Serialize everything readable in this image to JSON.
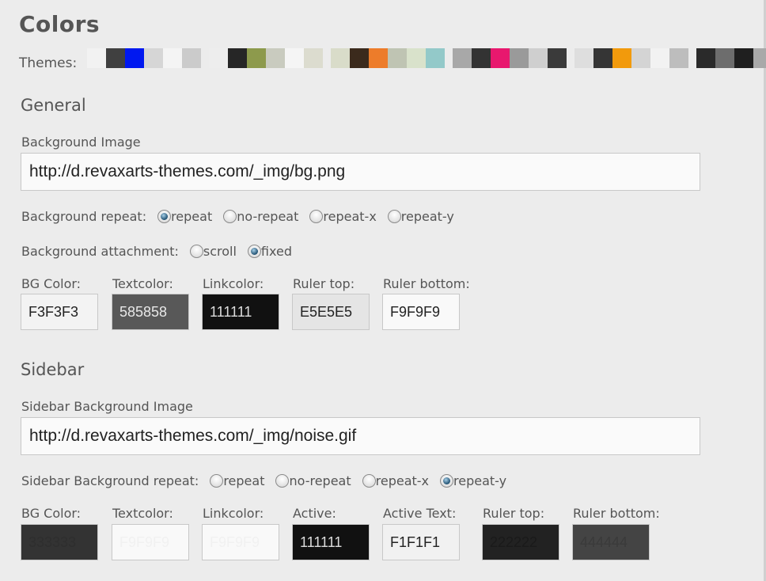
{
  "page": {
    "title": "Colors"
  },
  "themes": {
    "label": "Themes:",
    "sets": [
      [
        "#f2f2f2",
        "#404040",
        "#0018f0",
        "#d6d6d6",
        "#f4f4f4",
        "#cbcbcb"
      ],
      [
        "#ededed",
        "#262626",
        "#8d9a4c",
        "#c9cbbf",
        "#f5f5f5",
        "#dcdccf"
      ],
      [
        "#d9dcc9",
        "#3b2a1c",
        "#ed7c2a",
        "#bfc4b3",
        "#d9e2cb",
        "#93c9c9"
      ],
      [
        "#a8a8a8",
        "#333333",
        "#e8186e",
        "#9a9a9a",
        "#cfcfcf",
        "#3a3a3a"
      ],
      [
        "#dedede",
        "#353535",
        "#f29a0c",
        "#d4d4d4",
        "#f2f2f2",
        "#bdbdbd"
      ],
      [
        "#2a2a2a",
        "#6d6d6d",
        "#1f1f1f",
        "#a9a9a9"
      ]
    ]
  },
  "general": {
    "heading": "General",
    "bg_image_label": "Background Image",
    "bg_image_value": "http://d.revaxarts-themes.com/_img/bg.png",
    "repeat_label": "Background repeat:",
    "repeat_options": [
      "repeat",
      "no-repeat",
      "repeat-x",
      "repeat-y"
    ],
    "repeat_selected": "repeat",
    "attachment_label": "Background attachment:",
    "attachment_options": [
      "scroll",
      "fixed"
    ],
    "attachment_selected": "fixed",
    "colors": [
      {
        "label": "BG Color:",
        "value": "F3F3F3",
        "bg": "#f3f3f3",
        "fg": "#222222"
      },
      {
        "label": "Textcolor:",
        "value": "585858",
        "bg": "#585858",
        "fg": "#e8e8e8"
      },
      {
        "label": "Linkcolor:",
        "value": "111111",
        "bg": "#111111",
        "fg": "#dcdcdc"
      },
      {
        "label": "Ruler top:",
        "value": "E5E5E5",
        "bg": "#e5e5e5",
        "fg": "#222222"
      },
      {
        "label": "Ruler bottom:",
        "value": "F9F9F9",
        "bg": "#f9f9f9",
        "fg": "#222222"
      }
    ]
  },
  "sidebar": {
    "heading": "Sidebar",
    "bg_image_label": "Sidebar Background Image",
    "bg_image_value": "http://d.revaxarts-themes.com/_img/noise.gif",
    "repeat_label": "Sidebar Background repeat:",
    "repeat_options": [
      "repeat",
      "no-repeat",
      "repeat-x",
      "repeat-y"
    ],
    "repeat_selected": "repeat-y",
    "colors": [
      {
        "label": "BG Color:",
        "value": "333333",
        "bg": "#333333",
        "fg": "#2e2e2e"
      },
      {
        "label": "Textcolor:",
        "value": "F9F9F9",
        "bg": "#f9f9f9",
        "fg": "#f1f1f1"
      },
      {
        "label": "Linkcolor:",
        "value": "F9F9F9",
        "bg": "#f9f9f9",
        "fg": "#f1f1f1"
      },
      {
        "label": "Active:",
        "value": "111111",
        "bg": "#111111",
        "fg": "#dcdcdc"
      },
      {
        "label": "Active Text:",
        "value": "F1F1F1",
        "bg": "#f1f1f1",
        "fg": "#222222"
      },
      {
        "label": "Ruler top:",
        "value": "222222",
        "bg": "#222222",
        "fg": "#1a1a1a"
      },
      {
        "label": "Ruler bottom:",
        "value": "444444",
        "bg": "#444444",
        "fg": "#3a3a3a"
      }
    ]
  }
}
